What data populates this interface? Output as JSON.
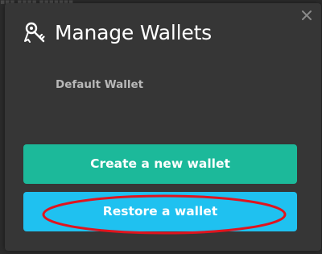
{
  "dialog": {
    "title": "Manage Wallets",
    "title_icon": "wallet-keys-icon",
    "close_icon": "close-icon"
  },
  "wallets": [
    {
      "label": "Default Wallet"
    }
  ],
  "buttons": {
    "create_label": "Create a new wallet",
    "restore_label": "Restore a wallet"
  },
  "annotation": {
    "highlight_target": "restore-wallet-button",
    "highlight_color": "#e0141e"
  },
  "colors": {
    "dialog_bg": "#363636",
    "create_button": "#1cb99a",
    "restore_button": "#1fc1f0",
    "wallet_text": "#b8b8b8"
  }
}
